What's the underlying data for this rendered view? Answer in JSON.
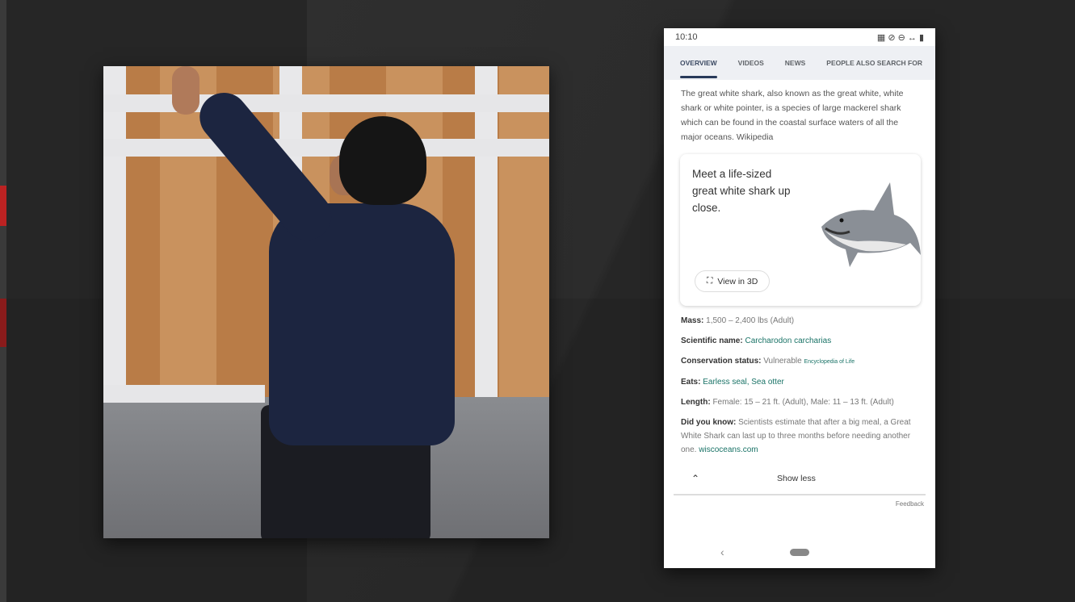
{
  "phone": {
    "status": {
      "time": "10:10",
      "icons": [
        "nfc-icon",
        "mute-icon",
        "dnd-icon",
        "data-icon",
        "battery-icon"
      ]
    },
    "tabs": [
      "OVERVIEW",
      "VIDEOS",
      "NEWS",
      "PEOPLE ALSO SEARCH FOR"
    ],
    "description": "The great white shark, also known as the great white, white shark or white pointer, is a species of large mackerel shark which can be found in the coastal surface waters of all the major oceans.",
    "description_source": "Wikipedia",
    "card": {
      "title": "Meet a life-sized great white shark up close.",
      "button": "View in 3D"
    },
    "facts": [
      {
        "label": "Mass:",
        "value": "1,500 – 2,400 lbs (Adult)"
      },
      {
        "label": "Scientific name:",
        "value": "Carcharodon carcharias"
      },
      {
        "label": "Conservation status:",
        "value": "Vulnerable",
        "source": "Encyclopedia of Life"
      },
      {
        "label": "Eats:",
        "value": "Earless seal, Sea otter"
      },
      {
        "label": "Length:",
        "value": "Female: 15 – 21 ft. (Adult), Male: 11 – 13 ft. (Adult)"
      },
      {
        "label": "Did you know:",
        "value": "Scientists estimate that after a big meal, a Great White Shark can last up to three months before needing another one.",
        "source": "wiscoceans.com"
      }
    ],
    "show_less": "Show less",
    "feedback": "Feedback"
  }
}
